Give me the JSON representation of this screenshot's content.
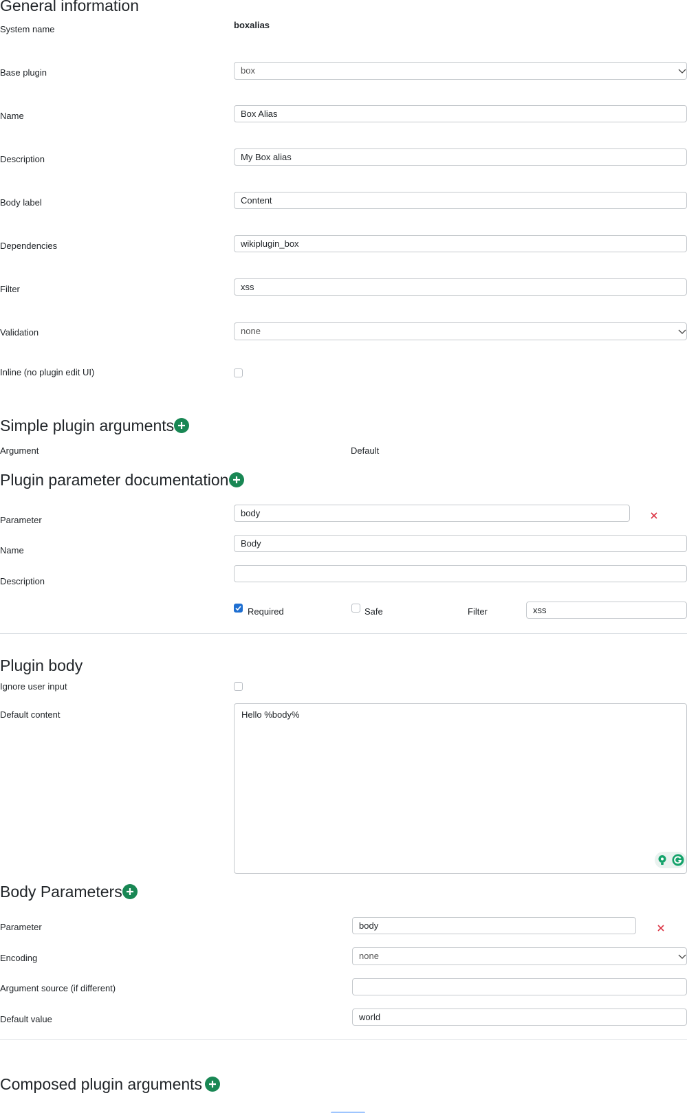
{
  "general": {
    "heading": "General information",
    "system_name_label": "System name",
    "system_name_value": "boxalias",
    "base_plugin_label": "Base plugin",
    "base_plugin_value": "box",
    "name_label": "Name",
    "name_value": "Box Alias",
    "description_label": "Description",
    "description_value": "My Box alias",
    "body_label_label": "Body label",
    "body_label_value": "Content",
    "dependencies_label": "Dependencies",
    "dependencies_value": "wikiplugin_box",
    "filter_label": "Filter",
    "filter_value": "xss",
    "validation_label": "Validation",
    "validation_value": "none",
    "inline_label": "Inline (no plugin edit UI)",
    "inline_checked": false
  },
  "simple_args": {
    "heading": "Simple plugin arguments",
    "argument_col": "Argument",
    "default_col": "Default"
  },
  "param_doc": {
    "heading": "Plugin parameter documentation",
    "parameter_label": "Parameter",
    "parameter_value": "body",
    "name_label": "Name",
    "name_value": "Body",
    "description_label": "Description",
    "description_value": "",
    "required_label": "Required",
    "required_checked": true,
    "safe_label": "Safe",
    "safe_checked": false,
    "filter_label": "Filter",
    "filter_value": "xss"
  },
  "plugin_body": {
    "heading": "Plugin body",
    "ignore_label": "Ignore user input",
    "ignore_checked": false,
    "default_content_label": "Default content",
    "default_content_value": "Hello %body%"
  },
  "body_params": {
    "heading": "Body Parameters",
    "parameter_label": "Parameter",
    "parameter_value": "body",
    "encoding_label": "Encoding",
    "encoding_value": "none",
    "arg_source_label": "Argument source (if different)",
    "arg_source_value": "",
    "default_value_label": "Default value",
    "default_value_value": "world"
  },
  "composed_args": {
    "heading": "Composed plugin arguments"
  },
  "colors": {
    "accent_green": "#198754",
    "remove_red": "#dc3545",
    "checkbox_blue": "#1f6fd1"
  }
}
